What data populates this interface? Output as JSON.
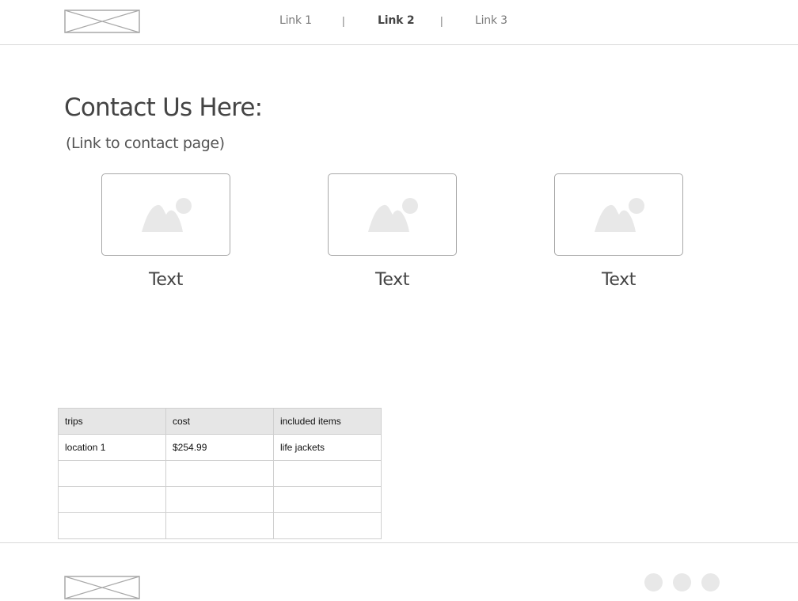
{
  "header": {
    "nav": [
      {
        "label": "Link 1",
        "active": false
      },
      {
        "label": "Link 2",
        "active": true
      },
      {
        "label": "Link 3",
        "active": false
      }
    ],
    "separator": "|"
  },
  "content": {
    "title": "Contact Us Here:",
    "link_text": "(Link to contact page)",
    "cards": [
      {
        "text": "Text"
      },
      {
        "text": "Text"
      },
      {
        "text": "Text"
      }
    ]
  },
  "table": {
    "headers": [
      "trips",
      "cost",
      "included items"
    ],
    "rows": [
      [
        "location 1",
        "$254.99",
        "life jackets"
      ],
      [
        "",
        "",
        ""
      ],
      [
        "",
        "",
        ""
      ],
      [
        "",
        "",
        ""
      ]
    ]
  },
  "footer": {
    "social_icons": [
      "social-icon",
      "social-icon",
      "social-icon"
    ]
  },
  "colors": {
    "border": "#d9d9d9",
    "placeholder": "#e8e8e8",
    "table_header_bg": "#e6e6e6",
    "text": "#444444"
  }
}
